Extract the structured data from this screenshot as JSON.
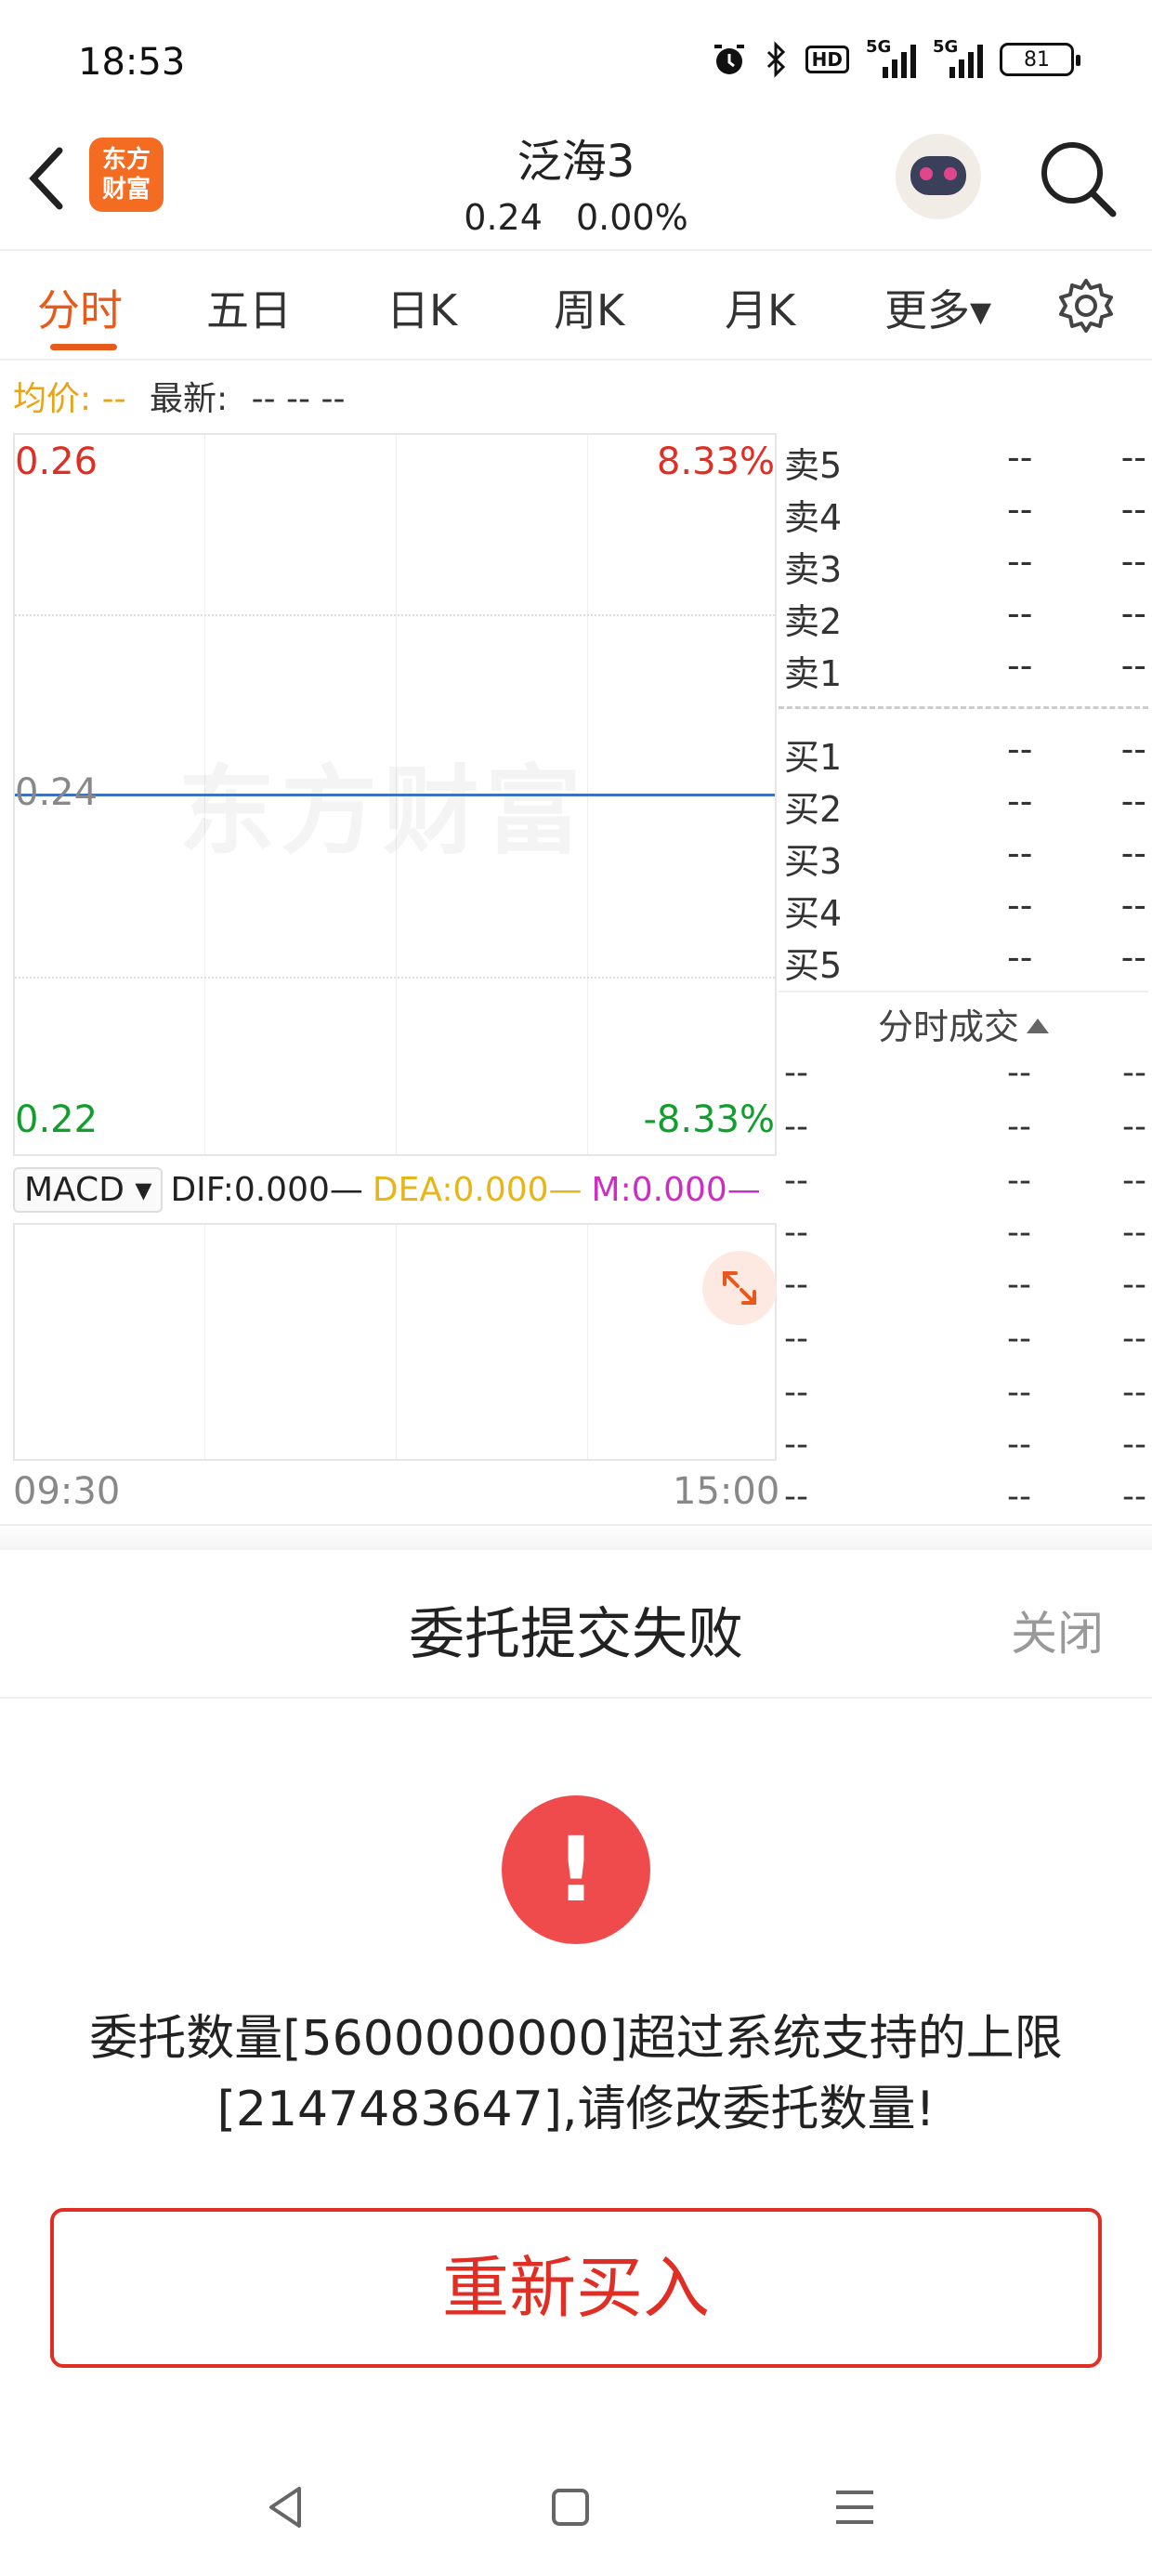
{
  "status_bar": {
    "time": "18:53",
    "network_1": "5G",
    "network_2": "5G",
    "hd": "HD",
    "battery": "81"
  },
  "header": {
    "logo_line1": "东方",
    "logo_line2": "财富",
    "title": "泛海3",
    "price": "0.24",
    "change_pct": "0.00%"
  },
  "tabs": [
    {
      "label": "分时",
      "active": true
    },
    {
      "label": "五日"
    },
    {
      "label": "日K"
    },
    {
      "label": "周K"
    },
    {
      "label": "月K"
    },
    {
      "label": "更多▾"
    }
  ],
  "info": {
    "avg_label": "均价:",
    "avg_value": "--",
    "latest_label": "最新:",
    "latest_values": "-- -- --"
  },
  "chart": {
    "watermark": "东方财富",
    "y_high": "0.26",
    "y_mid": "0.24",
    "y_low": "0.22",
    "pct_high": "8.33%",
    "pct_low": "-8.33%",
    "time_start": "09:30",
    "time_end": "15:00"
  },
  "chart_data": {
    "type": "line",
    "x": [
      "09:30",
      "15:00"
    ],
    "series": [
      {
        "values": [
          0.24,
          0.24
        ]
      }
    ],
    "ylim": [
      0.22,
      0.26
    ],
    "y_ticks": [
      "0.26",
      "0.24",
      "0.22"
    ],
    "right_ticks": [
      "8.33%",
      "-8.33%"
    ]
  },
  "macd": {
    "selector": "MACD ▾",
    "dif": "DIF:0.000—",
    "dea": "DEA:0.000—",
    "m": "M:0.000—"
  },
  "order_book": {
    "asks": [
      {
        "label": "卖5",
        "price": "--",
        "vol": "--"
      },
      {
        "label": "卖4",
        "price": "--",
        "vol": "--"
      },
      {
        "label": "卖3",
        "price": "--",
        "vol": "--"
      },
      {
        "label": "卖2",
        "price": "--",
        "vol": "--"
      },
      {
        "label": "卖1",
        "price": "--",
        "vol": "--"
      }
    ],
    "bids": [
      {
        "label": "买1",
        "price": "--",
        "vol": "--"
      },
      {
        "label": "买2",
        "price": "--",
        "vol": "--"
      },
      {
        "label": "买3",
        "price": "--",
        "vol": "--"
      },
      {
        "label": "买4",
        "price": "--",
        "vol": "--"
      },
      {
        "label": "买5",
        "price": "--",
        "vol": "--"
      }
    ]
  },
  "ticks": {
    "title": "分时成交",
    "rows": [
      {
        "t": "--",
        "p": "--",
        "v": "--"
      },
      {
        "t": "--",
        "p": "--",
        "v": "--"
      },
      {
        "t": "--",
        "p": "--",
        "v": "--"
      },
      {
        "t": "--",
        "p": "--",
        "v": "--"
      },
      {
        "t": "--",
        "p": "--",
        "v": "--"
      },
      {
        "t": "--",
        "p": "--",
        "v": "--"
      },
      {
        "t": "--",
        "p": "--",
        "v": "--"
      },
      {
        "t": "--",
        "p": "--",
        "v": "--"
      },
      {
        "t": "--",
        "p": "--",
        "v": "--"
      }
    ]
  },
  "dialog": {
    "title": "委托提交失败",
    "close": "关闭",
    "icon": "!",
    "message_line1": "委托数量[5600000000]超过系统支持的上限",
    "message_line2": "[2147483647],请修改委托数量!",
    "button": "重新买入"
  },
  "colors": {
    "accent": "#e85a1b",
    "up": "#e02e24",
    "down": "#109e2d",
    "price_line": "#3b73c2",
    "warn": "#f04b4c"
  }
}
